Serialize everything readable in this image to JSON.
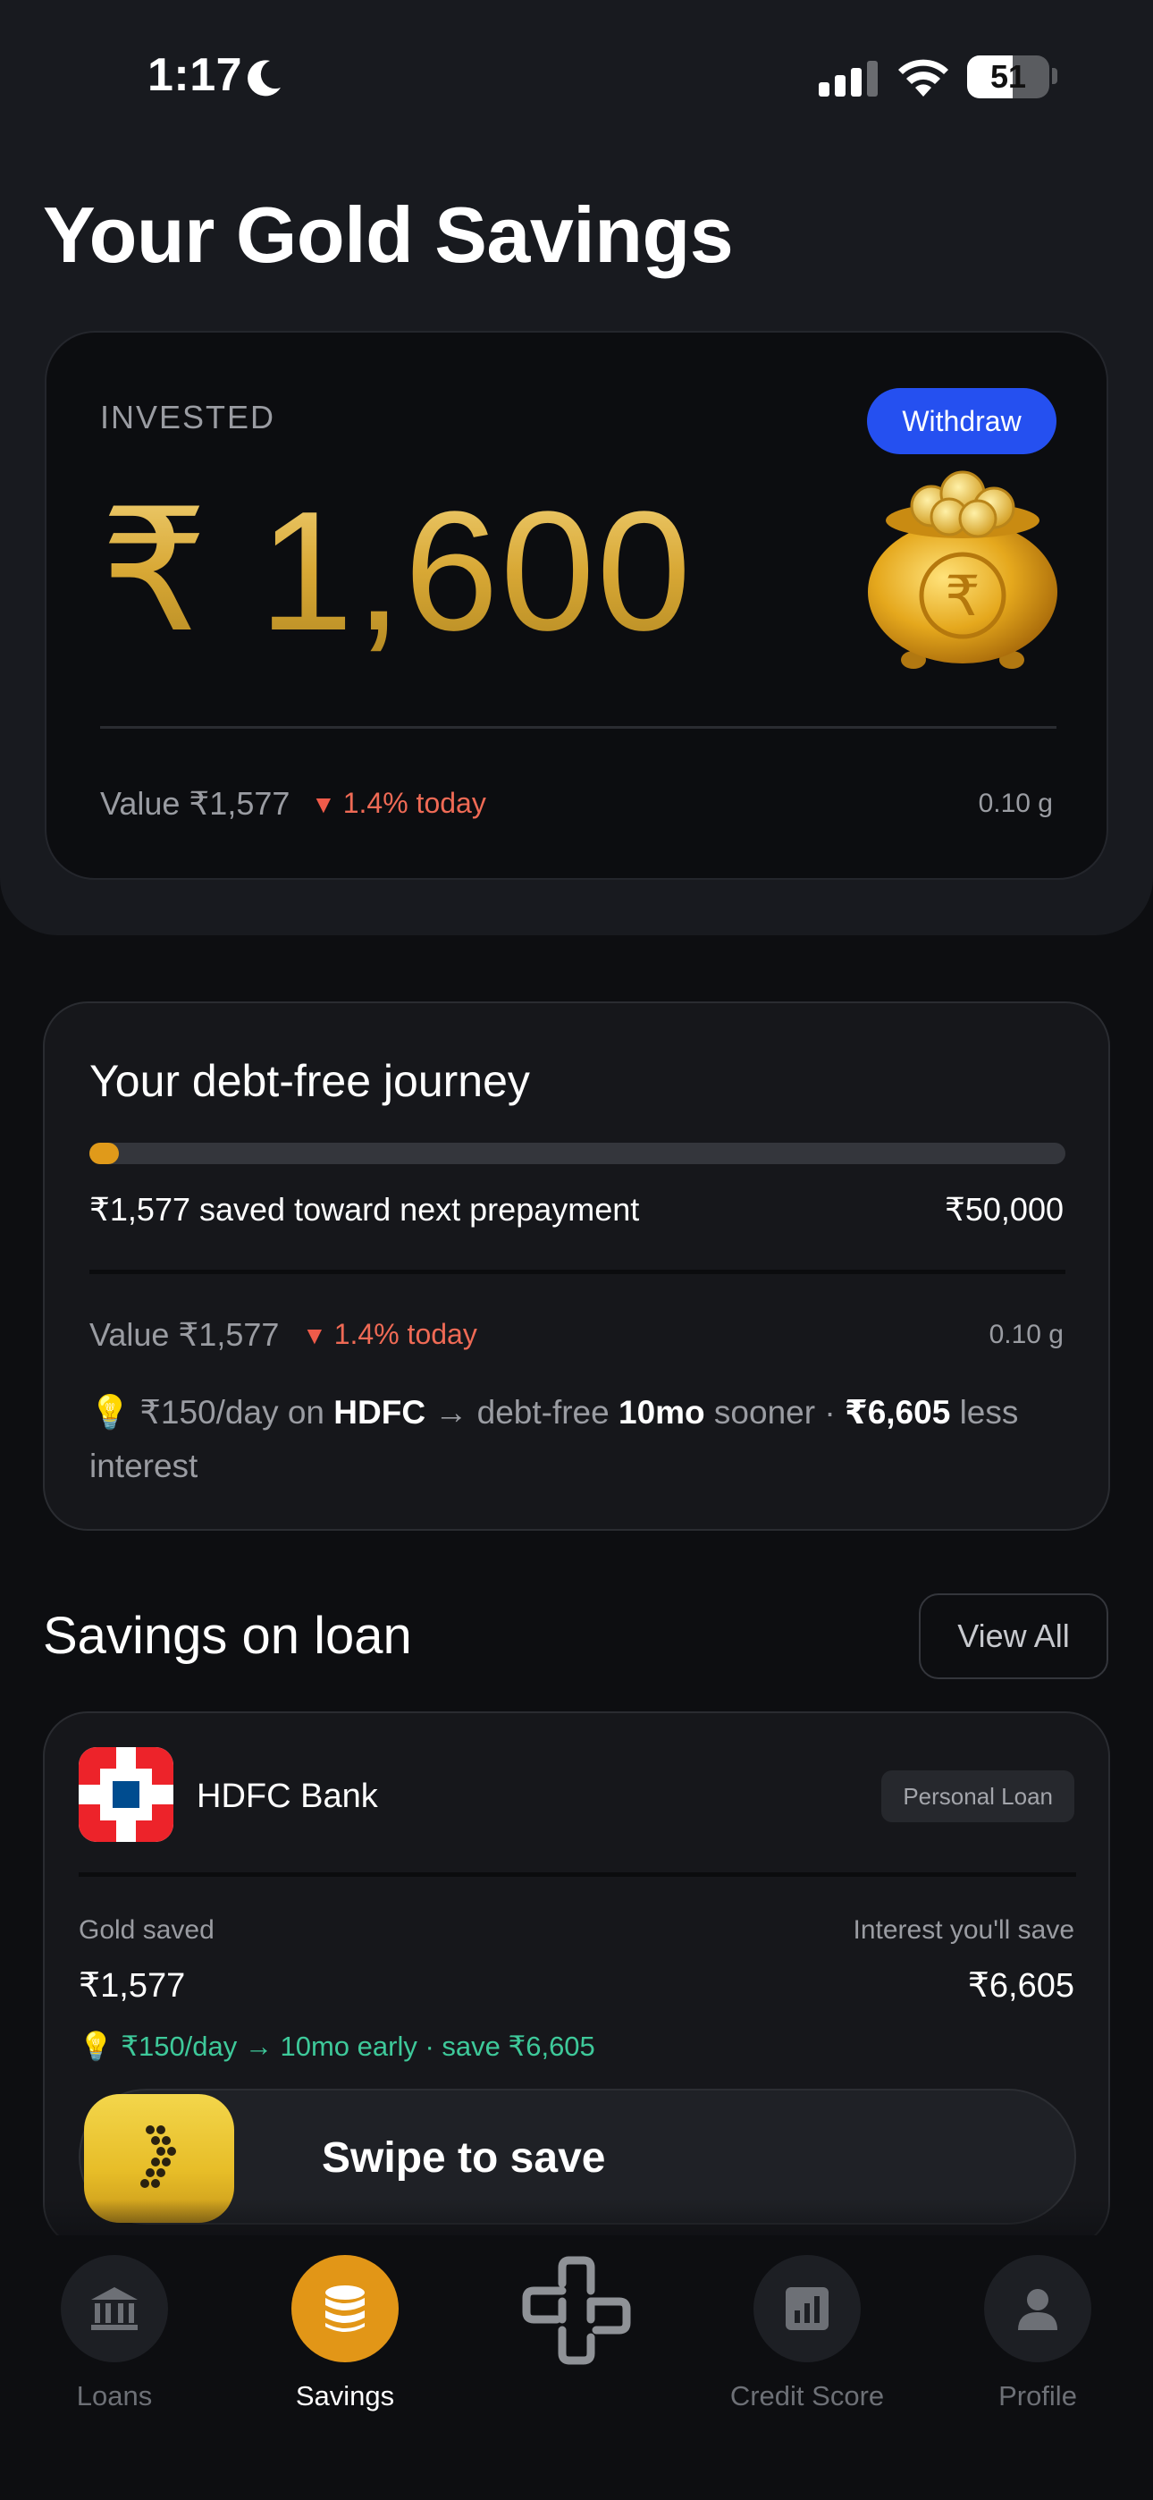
{
  "status_bar": {
    "time": "1:17",
    "battery": "51"
  },
  "page": {
    "title": "Your Gold Savings"
  },
  "invested_card": {
    "label": "INVESTED",
    "withdraw_label": "Withdraw",
    "amount": "₹ 1,600",
    "value": "Value ₹1,577",
    "change": "1.4% today",
    "grams": "0.10 g"
  },
  "journey": {
    "title": "Your debt-free journey",
    "progress_fraction": 0.03,
    "saved_text": "₹1,577 saved toward next prepayment",
    "target": "₹50,000",
    "value": "Value ₹1,577",
    "change": "1.4% today",
    "grams": "0.10 g",
    "tip_prefix": "₹150/day on ",
    "tip_bank": "HDFC",
    "tip_mid": " → debt-free ",
    "tip_months": "10mo",
    "tip_sooner": " sooner · ",
    "tip_amount": "₹6,605",
    "tip_suffix": " less interest"
  },
  "savings_section": {
    "title": "Savings on loan",
    "view_all_label": "View All"
  },
  "loan_card": {
    "bank_name": "HDFC Bank",
    "loan_type": "Personal Loan",
    "gold_saved_label": "Gold saved",
    "gold_saved_value": "₹1,577",
    "interest_label": "Interest you'll save",
    "interest_value": "₹6,605",
    "tip": "₹150/day → 10mo early · save ₹6,605",
    "swipe_label": "Swipe to save"
  },
  "bottom_nav": {
    "items": [
      {
        "label": "Loans",
        "icon": "bank-icon",
        "active": false
      },
      {
        "label": "Savings",
        "icon": "coins-stack-icon",
        "active": true
      },
      {
        "label": "",
        "icon": "app-logo-icon",
        "active": false
      },
      {
        "label": "Credit Score",
        "icon": "bar-chart-icon",
        "active": false
      },
      {
        "label": "Profile",
        "icon": "person-icon",
        "active": false
      }
    ]
  },
  "colors": {
    "accent_gold": "#e29617",
    "withdraw_blue": "#2550f0",
    "negative_red": "#ef6a55",
    "positive_green": "#3ec99a"
  }
}
